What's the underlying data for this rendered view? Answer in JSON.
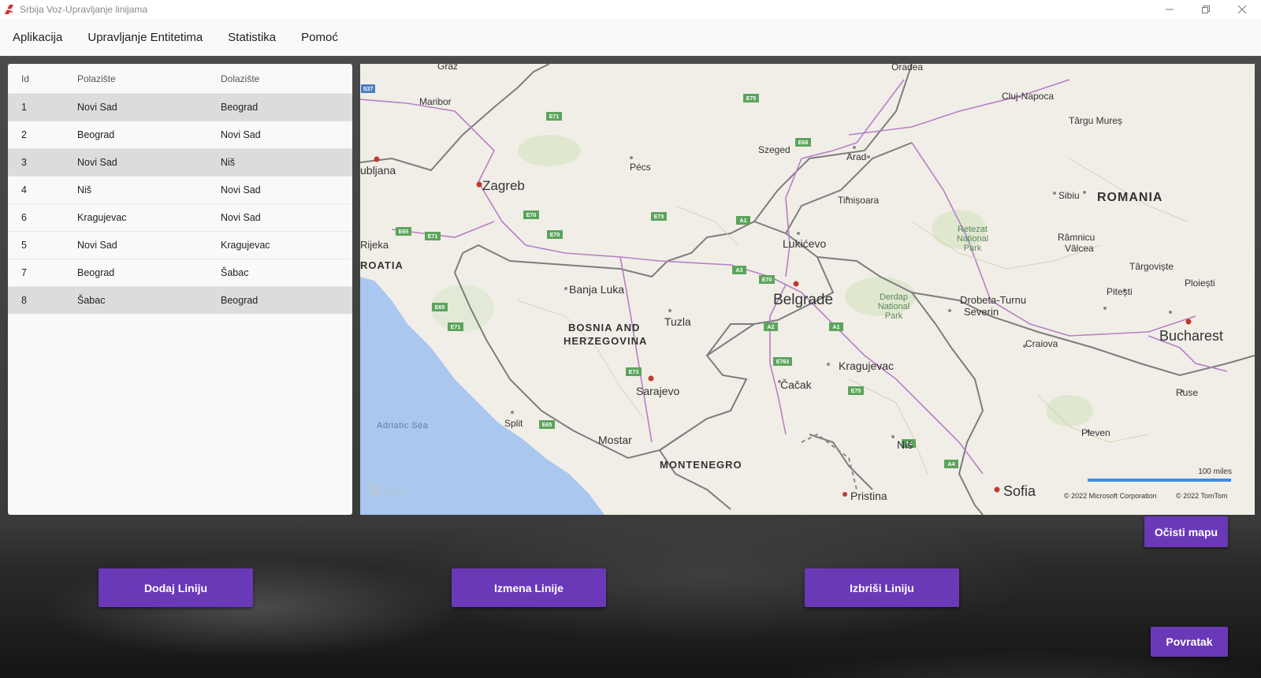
{
  "window": {
    "title": "Srbija Voz-Upravljanje linijama",
    "controls": [
      "minimize-icon",
      "restore-icon",
      "close-icon"
    ]
  },
  "menu": [
    "Aplikacija",
    "Upravljanje Entitetima",
    "Statistika",
    "Pomoć"
  ],
  "table": {
    "headers": [
      "Id",
      "Polazište",
      "Dolazište"
    ],
    "rows": [
      [
        "1",
        "Novi Sad",
        "Beograd"
      ],
      [
        "2",
        "Beograd",
        "Novi Sad"
      ],
      [
        "3",
        "Novi Sad",
        "Niš"
      ],
      [
        "4",
        "Niš",
        "Novi Sad"
      ],
      [
        "6",
        "Kragujevac",
        "Novi Sad"
      ],
      [
        "5",
        "Novi Sad",
        "Kragujevac"
      ],
      [
        "7",
        "Beograd",
        "Šabac"
      ],
      [
        "8",
        "Šabac",
        "Beograd"
      ]
    ]
  },
  "map": {
    "countries": [
      "ROATIA",
      "BOSNIA AND",
      "HERZEGOVINA",
      "MONTENEGRO",
      "ROMANIA"
    ],
    "cities": [
      "Graz",
      "Maribor",
      "ubljana",
      "Zagreb",
      "Rijeka",
      "Pécs",
      "Szeged",
      "Arad",
      "Oradea",
      "Cluj-Napoca",
      "Târgu Mureș",
      "Sibiu",
      "Timișoara",
      "Lukićevo",
      "Belgrade",
      "Banja Luka",
      "Tuzla",
      "Sarajevo",
      "Mostar",
      "Split",
      "Kragujevac",
      "Čačak",
      "Niš",
      "Pristina",
      "Sofia",
      "Craiova",
      "Bucharest",
      "Ruse",
      "Pleven",
      "Drobeta-Turnu",
      "Severin",
      "Râmnicu",
      "Vâlcea",
      "Târgoviște",
      "Ploiești",
      "Pitești"
    ],
    "parks": [
      "Retezat",
      "National",
      "Park",
      "Derdap",
      "National",
      "Park"
    ],
    "sea": "Adriatic Sea",
    "roads": [
      "E75",
      "E71",
      "E68",
      "E70",
      "E73",
      "E65",
      "A1",
      "A3",
      "A2",
      "E763",
      "A4",
      "S37"
    ],
    "scale": "100 miles",
    "brand": "bing",
    "attribution_ms": "© 2022 Microsoft Corporation",
    "attribution_tt": "© 2022 TomTom"
  },
  "buttons": {
    "clear_map": "Očisti mapu",
    "add_line": "Dodaj Liniju",
    "edit_line": "Izmena Linije",
    "delete_line": "Izbriši Liniju",
    "back": "Povratak"
  },
  "colors": {
    "button": "#6a39b8",
    "map_land": "#f1eee7",
    "map_water": "#a9c7ef",
    "highway": "#b77fc7",
    "row_alt": "#dcdcdc",
    "road_shield": "#5ca45c"
  }
}
